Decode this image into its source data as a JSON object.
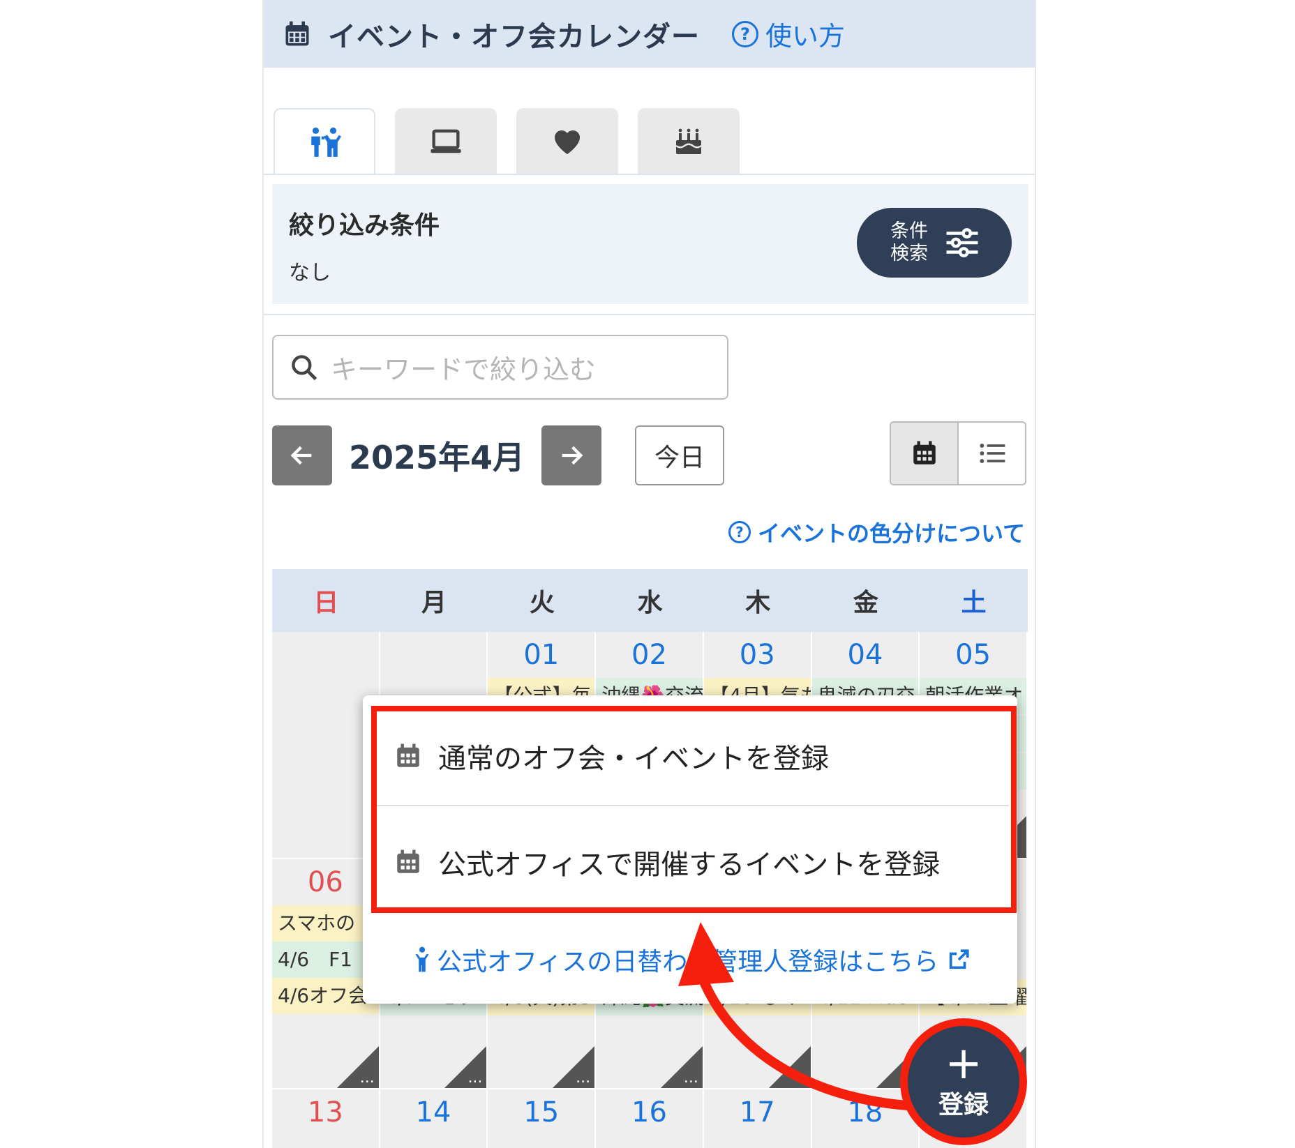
{
  "header": {
    "title": "イベント・オフ会カレンダー",
    "help_label": "使い方",
    "help_mark": "?"
  },
  "tabs": [
    {
      "icon": "people-icon",
      "active": true
    },
    {
      "icon": "laptop-icon",
      "active": false
    },
    {
      "icon": "heart-icon",
      "active": false
    },
    {
      "icon": "cake-icon",
      "active": false
    }
  ],
  "filter": {
    "title": "絞り込み条件",
    "value": "なし",
    "button_line1": "条件",
    "button_line2": "検索"
  },
  "search": {
    "placeholder": "キーワードで絞り込む"
  },
  "nav": {
    "month": "2025年4月",
    "today": "今日",
    "prev": "←",
    "next": "→"
  },
  "color_help": {
    "mark": "?",
    "label": "イベントの色分けについて"
  },
  "calendar": {
    "weekdays": [
      "日",
      "月",
      "火",
      "水",
      "木",
      "金",
      "土"
    ],
    "week1": {
      "days": [
        "",
        "",
        "01",
        "02",
        "03",
        "04",
        "05"
      ],
      "events": [
        "【公式】毎",
        "沖縄🌺交流",
        "【4月】気も",
        "鬼滅の刃交",
        "朝活作業オ"
      ]
    },
    "week2": {
      "days": [
        "06"
      ],
      "events_sun": [
        "スマホの",
        "4/6　F1",
        "4/6オフ会"
      ],
      "events_row3": [
        "4/7　モラ",
        "4/8(火)第3",
        "沖縄🌺交流",
        "4/10 もく",
        "4/11 Mac",
        "【4/12土曜"
      ]
    },
    "week3": {
      "days": [
        "13",
        "14",
        "15",
        "16",
        "17",
        "18"
      ]
    },
    "more_label": "..."
  },
  "dropdown": {
    "item1": "通常のオフ会・イベントを登録",
    "item2": "公式オフィスで開催するイベントを登録",
    "link": "公式オフィスの日替わり管理人登録はこちら"
  },
  "fab": {
    "plus": "+",
    "label": "登録"
  },
  "colors": {
    "accent": "#1a73d9",
    "header_bg": "#dce6f2",
    "highlight": "#f4200d",
    "fab": "#2f3f57"
  }
}
